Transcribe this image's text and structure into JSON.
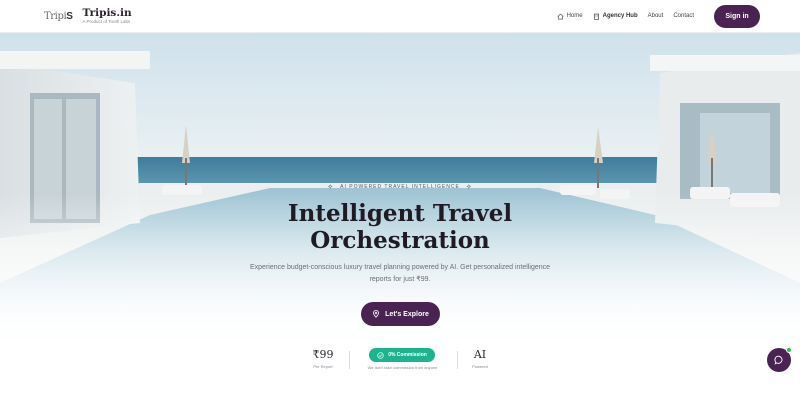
{
  "header": {
    "logo_mark_prefix": "Tripi",
    "logo_mark_suffix": "S",
    "brand_name": "Tripis.in",
    "brand_tagline": "A Product of Tooth Labs",
    "nav": [
      {
        "label": "Home",
        "icon": "home-icon"
      },
      {
        "label": "Agency Hub",
        "icon": "building-icon"
      },
      {
        "label": "About",
        "icon": ""
      },
      {
        "label": "Contact",
        "icon": ""
      }
    ],
    "signin_label": "Sign in"
  },
  "hero": {
    "eyebrow": "AI POWERED TRAVEL INTELLIGENCE",
    "title_line1": "Intelligent Travel",
    "title_line2": "Orchestration",
    "subtitle": "Experience budget-conscious luxury travel planning powered by AI. Get personalized intelligence reports for just ₹99.",
    "cta_label": "Let's Explore"
  },
  "stats": {
    "price_value": "₹99",
    "price_label": "Per Report",
    "commission_badge": "0% Commission",
    "commission_note": "We don't take commission from anyone",
    "ai_value": "AI",
    "ai_label": "Powered"
  },
  "colors": {
    "brand": "#4a2352",
    "badge": "#1bb48e",
    "title": "#1f1a24"
  }
}
